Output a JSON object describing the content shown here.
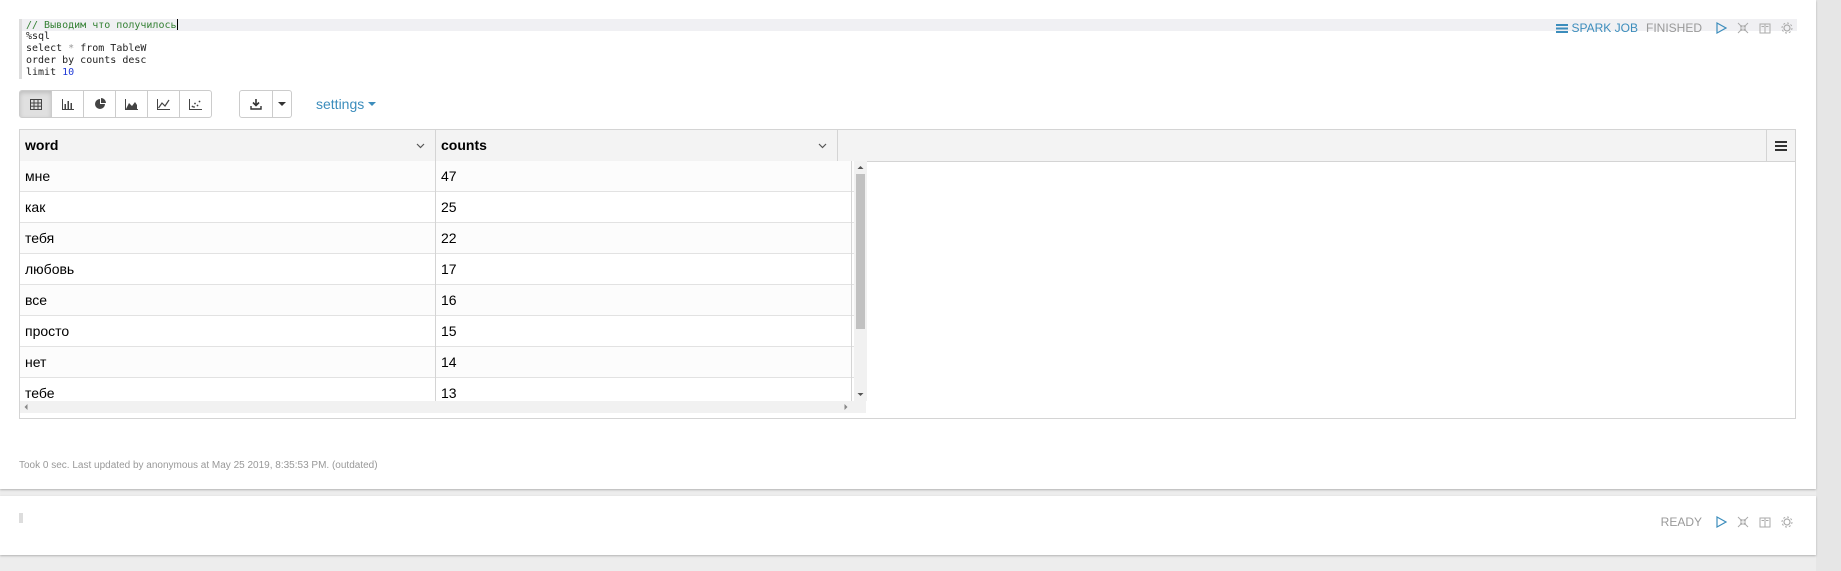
{
  "paragraph1": {
    "code_lines": [
      {
        "parts": [
          {
            "t": "// Выводим что получилось",
            "cls": "cm-comment"
          }
        ],
        "active": true
      },
      {
        "parts": [
          {
            "t": "%sql",
            "cls": ""
          }
        ]
      },
      {
        "parts": [
          {
            "t": "select ",
            "cls": ""
          },
          {
            "t": "*",
            "cls": "cm-op"
          },
          {
            "t": " from TableW",
            "cls": ""
          }
        ]
      },
      {
        "parts": [
          {
            "t": "order by counts desc",
            "cls": ""
          }
        ]
      },
      {
        "parts": [
          {
            "t": "limit ",
            "cls": ""
          },
          {
            "t": "10",
            "cls": "cm-num"
          }
        ]
      }
    ],
    "spark_job_label": "SPARK JOB",
    "status": "FINISHED",
    "settings_label": "settings",
    "table": {
      "columns": [
        "word",
        "counts"
      ],
      "rows": [
        [
          "мне",
          "47"
        ],
        [
          "как",
          "25"
        ],
        [
          "тебя",
          "22"
        ],
        [
          "любовь",
          "17"
        ],
        [
          "все",
          "16"
        ],
        [
          "просто",
          "15"
        ],
        [
          "нет",
          "14"
        ],
        [
          "тебе",
          "13"
        ]
      ]
    },
    "footer": "Took 0 sec. Last updated by anonymous at May 25 2019, 8:35:53 PM. (outdated)"
  },
  "paragraph2": {
    "status": "READY"
  },
  "colors": {
    "accent": "#3c8dbc",
    "muted": "#999999"
  }
}
